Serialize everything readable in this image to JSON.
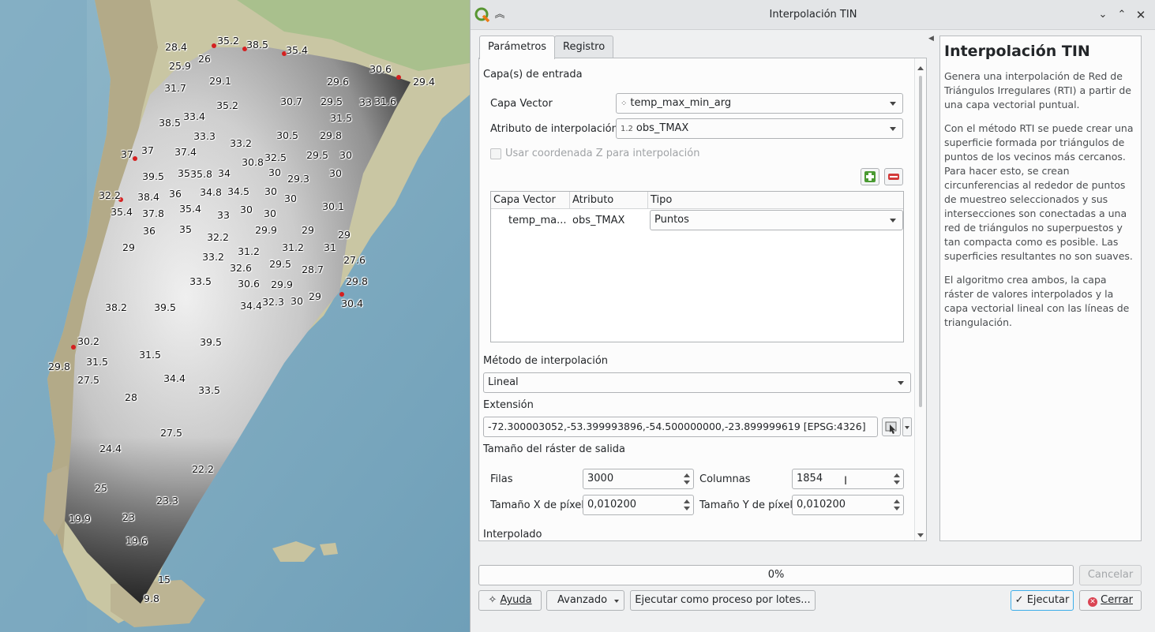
{
  "window": {
    "title": "Interpolación TIN"
  },
  "tabs": [
    {
      "label": "Parámetros"
    },
    {
      "label": "Registro"
    }
  ],
  "params": {
    "input_section": "Capa(s) de entrada",
    "vector_layer_label": "Capa Vector",
    "vector_layer_value": "temp_max_min_arg",
    "interp_attr_label": "Atributo de interpolación",
    "interp_attr_prefix": "1.2",
    "interp_attr_value": "obs_TMAX",
    "use_z_label": "Usar coordenada Z para interpolación",
    "table": {
      "headers": [
        "Capa Vector",
        "Atributo",
        "Tipo"
      ],
      "rows": [
        {
          "layer": "temp_ma...",
          "attribute": "obs_TMAX",
          "type": "Puntos"
        }
      ]
    },
    "method_label": "Método de interpolación",
    "method_value": "Lineal",
    "extent_label": "Extensión",
    "extent_value": "-72.300003052,-53.399993896,-54.500000000,-23.899999619 [EPSG:4326]",
    "raster_size_label": "Tamaño del ráster de salida",
    "rows_label": "Filas",
    "rows_value": "3000",
    "columns_label": "Columnas",
    "columns_value": "1854",
    "pixel_x_label": "Tamaño X de píxel",
    "pixel_x_value": "0,010200",
    "pixel_y_label": "Tamaño Y de píxel",
    "pixel_y_value": "0,010200",
    "interpolated_label": "Interpolado"
  },
  "help": {
    "title": "Interpolación TIN",
    "paragraphs": [
      "Genera una interpolación de Red de Triángulos Irregulares (RTI) a partir de una capa vectorial puntual.",
      "Con el método RTI se puede crear una superficie formada por triángulos de puntos de los vecinos más cercanos. Para hacer esto, se crean circunferencias al rededor de puntos de muestreo seleccionados y sus intersecciones son conectadas a una red de triángulos no superpuestos y tan compacta como es posible. Las superficies resultantes no son suaves.",
      "El algoritmo crea ambos, la capa ráster de valores interpolados y la capa vectorial lineal con las líneas de triangulación."
    ]
  },
  "progress": {
    "text": "0%",
    "value": 0
  },
  "buttons": {
    "cancel": "Cancelar",
    "help": "Ayuda",
    "advanced": "Avanzado",
    "batch": "Ejecutar como proceso por lotes...",
    "run": "Ejecutar",
    "close": "Cerrar"
  },
  "map": {
    "labels": [
      "28.4",
      "35.2",
      "38.5",
      "35.4",
      "26",
      "25.9",
      "30.6",
      "29.4",
      "29.1",
      "29.6",
      "31.7",
      "35.2",
      "30.7",
      "29.5",
      "33",
      "31.6",
      "31.5",
      "38.5",
      "33.4",
      "33.3",
      "30.5",
      "29.8",
      "33.2",
      "37",
      "37",
      "37.4",
      "32.5",
      "29.5",
      "30",
      "30.8",
      "39.5",
      "35",
      "35.8",
      "34",
      "30",
      "29.3",
      "30",
      "32.2",
      "38.4",
      "36",
      "34.8",
      "34.5",
      "30",
      "30",
      "35.4",
      "37.8",
      "35.4",
      "33",
      "30",
      "30",
      "30.1",
      "36",
      "35",
      "32.2",
      "29.9",
      "29",
      "29",
      "31.2",
      "31",
      "29",
      "33.2",
      "31.2",
      "27.6",
      "32.6",
      "29.5",
      "28.7",
      "33.5",
      "30.6",
      "29.9",
      "29.8",
      "34.4",
      "32.3",
      "30",
      "29",
      "30.4",
      "38.2",
      "39.5",
      "39.5",
      "30.2",
      "31.5",
      "29.8",
      "31.5",
      "27.5",
      "34.4",
      "33.5",
      "28",
      "27.5",
      "24.4",
      "22.2",
      "25",
      "23.3",
      "19.9",
      "23",
      "19.6",
      "15",
      "9.8"
    ]
  }
}
